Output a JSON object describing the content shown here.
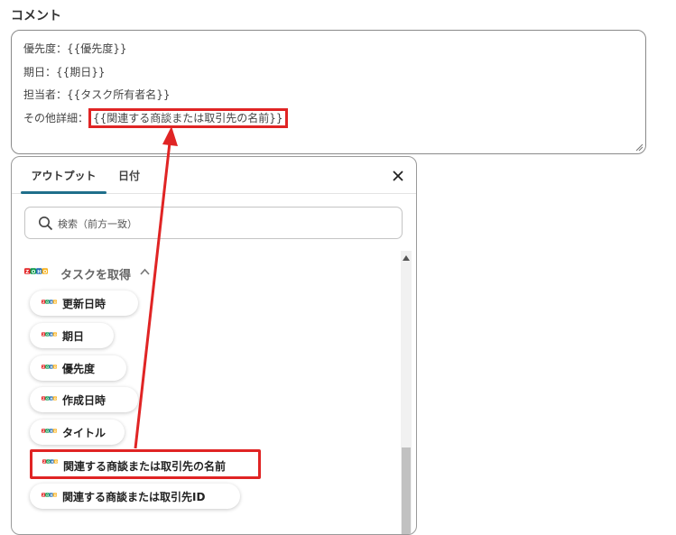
{
  "section": {
    "label": "コメント"
  },
  "comment": {
    "lines": [
      {
        "text": "優先度：{{優先度}}"
      },
      {
        "text": "期日：{{期日}}"
      },
      {
        "text": "担当者：{{タスク所有者名}}"
      },
      {
        "prefix": "その他詳細：",
        "highlight": "{{関連する商談または取引先の名前}}"
      }
    ]
  },
  "panel": {
    "tabs": [
      {
        "label": "アウトプット",
        "active": true
      },
      {
        "label": "日付",
        "active": false
      }
    ],
    "search": {
      "placeholder": "検索（前方一致）"
    },
    "group": {
      "title": "タスクを取得"
    },
    "items": [
      {
        "label": "更新日時"
      },
      {
        "label": "期日"
      },
      {
        "label": "優先度"
      },
      {
        "label": "作成日時"
      },
      {
        "label": "タイトル"
      },
      {
        "label": "関連する商談または取引先の名前",
        "selected": true
      },
      {
        "label": "関連する商談または取引先ID"
      }
    ]
  },
  "colors": {
    "highlight": "#e02424",
    "tab_underline": "#1f6f8b"
  },
  "icons": {
    "app": "zoho-logo-icon",
    "search": "search-icon",
    "close": "close-icon",
    "collapse": "chevron-up-icon"
  }
}
